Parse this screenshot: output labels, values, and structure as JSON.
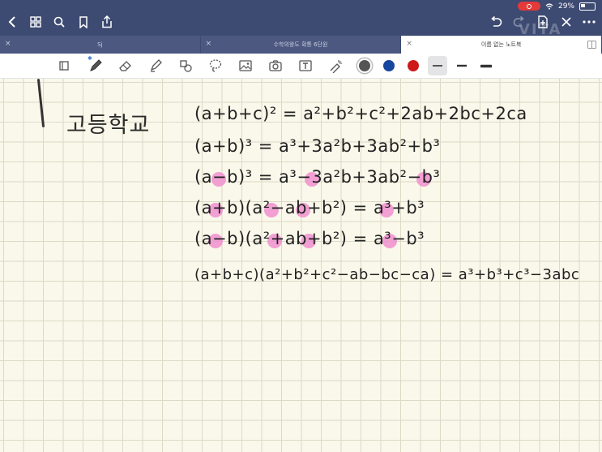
{
  "status": {
    "battery": "29%"
  },
  "tabs": [
    {
      "label": "Sj",
      "active": false
    },
    {
      "label": "수학의왕도 확통 6단원",
      "active": false
    },
    {
      "label": "이름 없는 노트북",
      "active": true
    }
  ],
  "notebook": {
    "label": "고등학교",
    "equations": [
      "(a+b+c)² = a²+b²+c²+2ab+2bc+2ca",
      "(a+b)³ = a³+3a²b+3ab²+b³",
      "(a−b)³ = a³−3a²b+3ab²−b³",
      "(a+b)(a²−ab+b²) = a³+b³",
      "(a−b)(a²+ab+b²) = a³−b³",
      "(a+b+c)(a²+b²+c²−ab−bc−ca) = a³+b³+c³−3abc"
    ]
  },
  "colors": {
    "ink_gray": "#555555",
    "ink_blue": "#17469e",
    "ink_red": "#cc1a1a",
    "highlight": "#f08fcf",
    "topbar": "#3d4a72"
  },
  "watermark": "VITA"
}
